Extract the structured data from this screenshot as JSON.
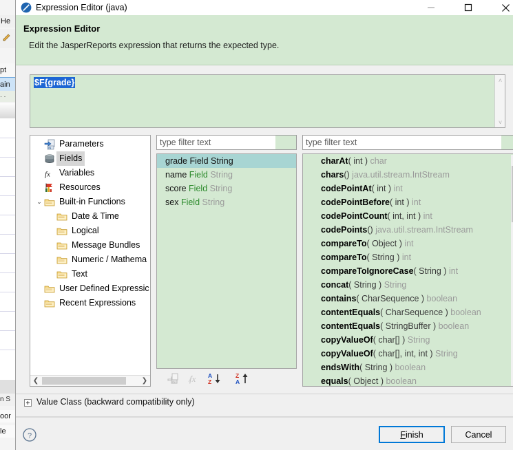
{
  "background_window": {
    "menu_fragment": "He",
    "tab_fragment": "pt",
    "tab_selected_fragment": "ain",
    "ruler_fragment": "· ·",
    "lower_tab_fragment": "n  S",
    "low_line_1": "oor",
    "low_line_2": "le"
  },
  "window": {
    "title": "Expression Editor (java)",
    "icon": "jasper-logo-icon",
    "minimize": "—",
    "maximize": "☐",
    "close": "✕"
  },
  "banner": {
    "title": "Expression Editor",
    "subtitle": "Edit the JasperReports expression that returns the expected type."
  },
  "expression": {
    "value": "$F{grade}",
    "selected": true,
    "selection_color": "#1d66d4",
    "background_color": "#d4e9d2"
  },
  "tree": {
    "items": [
      {
        "label": "Parameters",
        "icon": "parameters-icon",
        "indent": 0,
        "twist": "",
        "selected": false
      },
      {
        "label": "Fields",
        "icon": "fields-icon",
        "indent": 0,
        "twist": "",
        "selected": true
      },
      {
        "label": "Variables",
        "icon": "variables-fx-icon",
        "indent": 0,
        "twist": "",
        "selected": false
      },
      {
        "label": "Resources",
        "icon": "resources-icon",
        "indent": 0,
        "twist": "",
        "selected": false
      },
      {
        "label": "Built-in Functions",
        "icon": "folder-icon",
        "indent": 0,
        "twist": "⌄",
        "selected": false
      },
      {
        "label": "Date & Time",
        "icon": "folder-icon",
        "indent": 1,
        "twist": "",
        "selected": false
      },
      {
        "label": "Logical",
        "icon": "folder-icon",
        "indent": 1,
        "twist": "",
        "selected": false
      },
      {
        "label": "Message Bundles",
        "icon": "folder-icon",
        "indent": 1,
        "twist": "",
        "selected": false
      },
      {
        "label": "Numeric / Mathema",
        "icon": "folder-icon",
        "indent": 1,
        "twist": "",
        "selected": false
      },
      {
        "label": "Text",
        "icon": "folder-icon",
        "indent": 1,
        "twist": "",
        "selected": false
      },
      {
        "label": "User Defined Expressic",
        "icon": "folder-icon",
        "indent": 0,
        "twist": "",
        "selected": false
      },
      {
        "label": "Recent Expressions",
        "icon": "folder-icon",
        "indent": 0,
        "twist": "",
        "selected": false
      }
    ],
    "hscroll": {
      "left_arrow": "❮",
      "right_arrow": "❯"
    }
  },
  "middle_panel": {
    "filter_placeholder": "type filter text",
    "items": [
      {
        "name": "grade",
        "kind": "Field",
        "type": "String",
        "selected": true
      },
      {
        "name": "name",
        "kind": "Field",
        "type": "String",
        "selected": false
      },
      {
        "name": "score",
        "kind": "Field",
        "type": "String",
        "selected": false
      },
      {
        "name": "sex",
        "kind": "Field",
        "type": "String",
        "selected": false
      }
    ],
    "sort_buttons": [
      {
        "icon": "insert-parameter-icon",
        "enabled": false
      },
      {
        "icon": "insert-function-fx-icon",
        "enabled": false
      },
      {
        "icon": "sort-ascending-az-icon",
        "enabled": true
      },
      {
        "icon": "sort-descending-za-icon",
        "enabled": true
      }
    ]
  },
  "right_panel": {
    "filter_placeholder": "type filter text",
    "methods": [
      {
        "name": "charAt",
        "params": "( int )",
        "ret": "char"
      },
      {
        "name": "chars",
        "params": "()",
        "ret": "java.util.stream.IntStream"
      },
      {
        "name": "codePointAt",
        "params": "( int )",
        "ret": "int"
      },
      {
        "name": "codePointBefore",
        "params": "( int )",
        "ret": "int"
      },
      {
        "name": "codePointCount",
        "params": "( int, int )",
        "ret": "int"
      },
      {
        "name": "codePoints",
        "params": "()",
        "ret": "java.util.stream.IntStream"
      },
      {
        "name": "compareTo",
        "params": "( Object )",
        "ret": "int"
      },
      {
        "name": "compareTo",
        "params": "( String )",
        "ret": "int"
      },
      {
        "name": "compareToIgnoreCase",
        "params": "( String )",
        "ret": "int"
      },
      {
        "name": "concat",
        "params": "( String )",
        "ret": "String"
      },
      {
        "name": "contains",
        "params": "( CharSequence )",
        "ret": "boolean"
      },
      {
        "name": "contentEquals",
        "params": "( CharSequence )",
        "ret": "boolean"
      },
      {
        "name": "contentEquals",
        "params": "( StringBuffer )",
        "ret": "boolean"
      },
      {
        "name": "copyValueOf",
        "params": "( char[] )",
        "ret": "String"
      },
      {
        "name": "copyValueOf",
        "params": "( char[], int, int )",
        "ret": "String"
      },
      {
        "name": "endsWith",
        "params": "( String )",
        "ret": "boolean"
      },
      {
        "name": "equals",
        "params": "( Object )",
        "ret": "boolean"
      }
    ],
    "scroll": {
      "up_arrow": "˄",
      "down_arrow": "˅"
    }
  },
  "value_class": {
    "label": "Value Class (backward compatibility only)",
    "expanded": false
  },
  "footer": {
    "help_icon": "help-question-icon",
    "finish_label": "Finish",
    "finish_mnemonic": "F",
    "cancel_label": "Cancel"
  },
  "colors": {
    "banner_green": "#d4e9d2",
    "list_green": "#d4e9d2",
    "selection_blue": "#1d66d4",
    "row_selection": "#a8d5d3",
    "default_button_border": "#0078d7",
    "keyword_green": "#2c8a2c",
    "type_gray": "#9a9a9a"
  }
}
